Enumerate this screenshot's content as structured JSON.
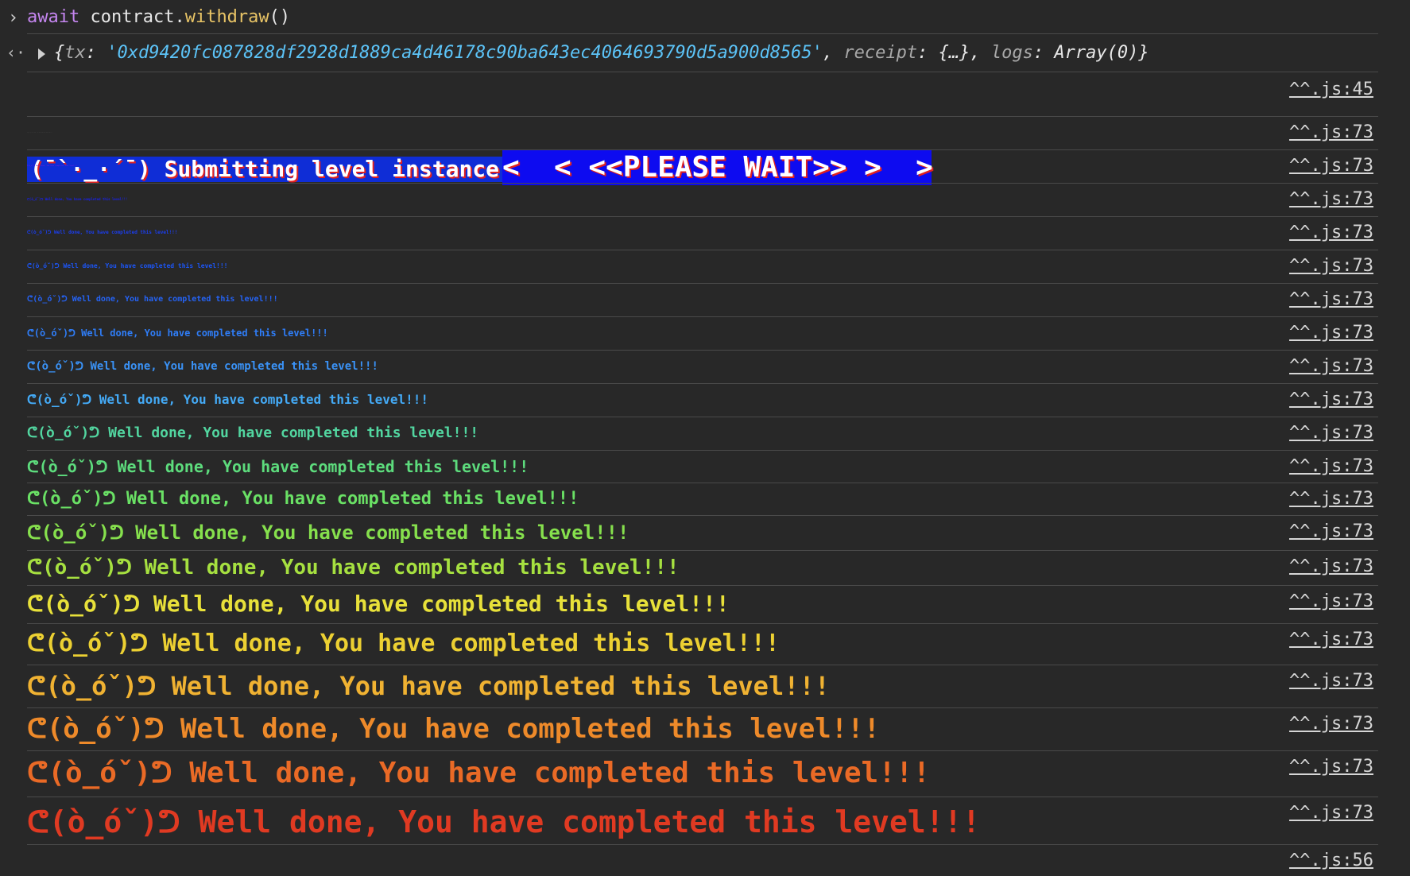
{
  "prompt": {
    "keyword": "await",
    "object": "contract.",
    "method": "withdraw",
    "parens": "()"
  },
  "result": {
    "open": "{",
    "tx_key": "tx",
    "tx_value": "'0xd9420fc087828df2928d1889ca4d46178c90ba643ec4064693790d5a900d8565'",
    "receipt_key": "receipt",
    "receipt_value": "{…}",
    "logs_key": "logs",
    "logs_value": "Array(0)",
    "close": "}"
  },
  "submit": {
    "message": "(¯`·_·´¯) Submitting level instance...",
    "wait": "<  < <<PLEASE WAIT>> >  >",
    "source": "^^.js:45"
  },
  "level_message": "ᕦ(ò_óˇ)ᕤ Well done, You have completed this level!!!",
  "logs": [
    {
      "source": "^^.js:73",
      "color": "#4a4a4a"
    },
    {
      "source": "^^.js:73",
      "color": "#6a1de0"
    },
    {
      "source": "^^.js:73",
      "color": "#1a22e8"
    },
    {
      "source": "^^.js:73",
      "color": "#1b3ef0"
    },
    {
      "source": "^^.js:73",
      "color": "#1c55f5"
    },
    {
      "source": "^^.js:73",
      "color": "#2563f5"
    },
    {
      "source": "^^.js:73",
      "color": "#2f7df7"
    },
    {
      "source": "^^.js:73",
      "color": "#3a92f6"
    },
    {
      "source": "^^.js:73",
      "color": "#44aaf6"
    },
    {
      "source": "^^.js:73",
      "color": "#52d6a0"
    },
    {
      "source": "^^.js:73",
      "color": "#5ddc7d"
    },
    {
      "source": "^^.js:73",
      "color": "#6ae165"
    },
    {
      "source": "^^.js:73",
      "color": "#86e04d"
    },
    {
      "source": "^^.js:73",
      "color": "#a6e040"
    },
    {
      "source": "^^.js:73",
      "color": "#e8e13a"
    },
    {
      "source": "^^.js:73",
      "color": "#ecd032"
    },
    {
      "source": "^^.js:73",
      "color": "#f0b232"
    },
    {
      "source": "^^.js:73",
      "color": "#ee8a2a"
    },
    {
      "source": "^^.js:73",
      "color": "#ea6a26"
    },
    {
      "source": "^^.js:73",
      "color": "#e03a22"
    }
  ],
  "final_source": "^^.js:56"
}
